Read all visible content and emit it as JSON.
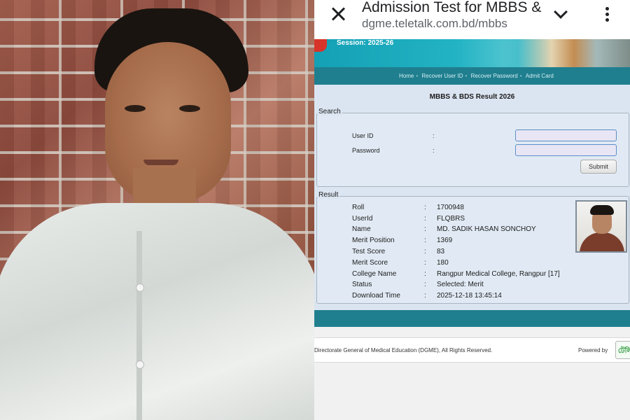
{
  "browser": {
    "title": "Admission Test for MBBS &",
    "url": "dgme.teletalk.com.bd/mbbs",
    "icons": [
      "close-icon",
      "chevron-down-icon",
      "more-vert-icon"
    ]
  },
  "banner": {
    "session": "Session: 2025-26"
  },
  "nav": {
    "links": [
      "Home",
      "Recover User ID",
      "Recover Password",
      "Admit Card"
    ],
    "separator": "•"
  },
  "main": {
    "heading": "MBBS & BDS Result 2026",
    "search": {
      "legend": "Search",
      "user_id_label": "User ID",
      "password_label": "Password",
      "colon": ":",
      "user_id_value": "",
      "password_value": "",
      "submit_label": "Submit"
    },
    "result": {
      "legend": "Result",
      "colon": ":",
      "rows": [
        {
          "label": "Roll",
          "value": "1700948"
        },
        {
          "label": "UserId",
          "value": "FLQBRS"
        },
        {
          "label": "Name",
          "value": "MD. SADIK HASAN SONCHOY"
        },
        {
          "label": "Merit Position",
          "value": "1369"
        },
        {
          "label": "Test Score",
          "value": "83"
        },
        {
          "label": "Merit Score",
          "value": "180"
        },
        {
          "label": "College Name",
          "value": "Rangpur Medical College, Rangpur [17]"
        },
        {
          "label": "Status",
          "value": "Selected: Merit"
        },
        {
          "label": "Download Time",
          "value": "2025-12-18 13:45:14"
        }
      ]
    }
  },
  "footer": {
    "copyright": "Directorate General of Medical Education (DGME), All Rights Reserved.",
    "powered_by": "Powered by",
    "logo_text": "টেলি"
  },
  "colors": {
    "banner": "#14a0b5",
    "navbar": "#1f7f8f",
    "content_bg": "#dbe5f1",
    "input_border": "#5a8ec7"
  }
}
